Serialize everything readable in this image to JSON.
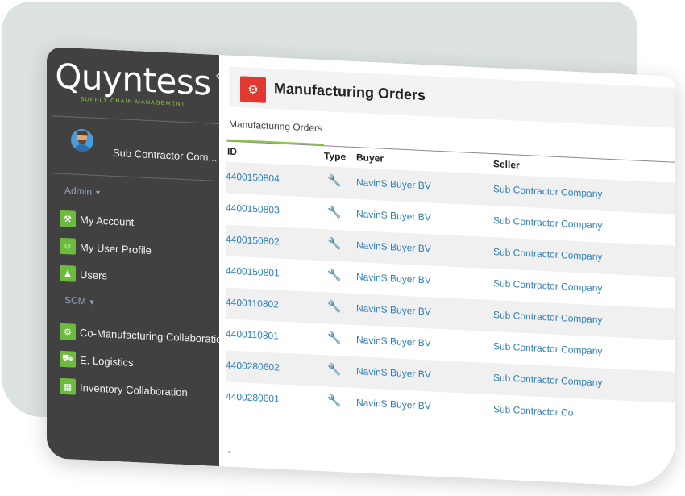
{
  "app": {
    "logo": "Quyntess",
    "tagline": "SUPPLY CHAIN MANAGEMENT"
  },
  "user": {
    "name": "Sub Contractor Com..."
  },
  "sidebar": {
    "sections": [
      {
        "label": "Admin"
      },
      {
        "label": "SCM"
      }
    ],
    "items": [
      {
        "label": "My Account",
        "icon": "account-icon"
      },
      {
        "label": "My User Profile",
        "icon": "user-profile-icon"
      },
      {
        "label": "Users",
        "icon": "users-icon"
      },
      {
        "label": "Co-Manufacturing Collaboration",
        "icon": "co-manufacturing-icon"
      },
      {
        "label": "E. Logistics",
        "icon": "logistics-icon"
      },
      {
        "label": "Inventory Collaboration",
        "icon": "inventory-icon"
      }
    ]
  },
  "header": {
    "title": "Manufacturing Orders",
    "icon": "manufacturing-icon"
  },
  "tabs": [
    {
      "label": "Manufacturing Orders",
      "active": true
    }
  ],
  "table": {
    "columns": [
      "ID",
      "Type",
      "Buyer",
      "Seller"
    ],
    "rows": [
      {
        "id": "4400150804",
        "type": "wrench-icon",
        "buyer": "NavinS Buyer BV",
        "seller": "Sub Contractor Company"
      },
      {
        "id": "4400150803",
        "type": "wrench-icon",
        "buyer": "NavinS Buyer BV",
        "seller": "Sub Contractor Company"
      },
      {
        "id": "4400150802",
        "type": "wrench-icon",
        "buyer": "NavinS Buyer BV",
        "seller": "Sub Contractor Company"
      },
      {
        "id": "4400150801",
        "type": "wrench-icon",
        "buyer": "NavinS Buyer BV",
        "seller": "Sub Contractor Company"
      },
      {
        "id": "4400110802",
        "type": "wrench-icon",
        "buyer": "NavinS Buyer BV",
        "seller": "Sub Contractor Company"
      },
      {
        "id": "4400110801",
        "type": "wrench-icon",
        "buyer": "NavinS Buyer BV",
        "seller": "Sub Contractor Company"
      },
      {
        "id": "4400280602",
        "type": "wrench-icon",
        "buyer": "NavinS Buyer BV",
        "seller": "Sub Contractor Company"
      },
      {
        "id": "4400280601",
        "type": "wrench-icon",
        "buyer": "NavinS Buyer BV",
        "seller": "Sub Contractor Co"
      }
    ]
  },
  "colors": {
    "sidebar": "#414142",
    "accent": "#8dc63f",
    "header_icon": "#e2382f",
    "link": "#2d7fb8"
  }
}
